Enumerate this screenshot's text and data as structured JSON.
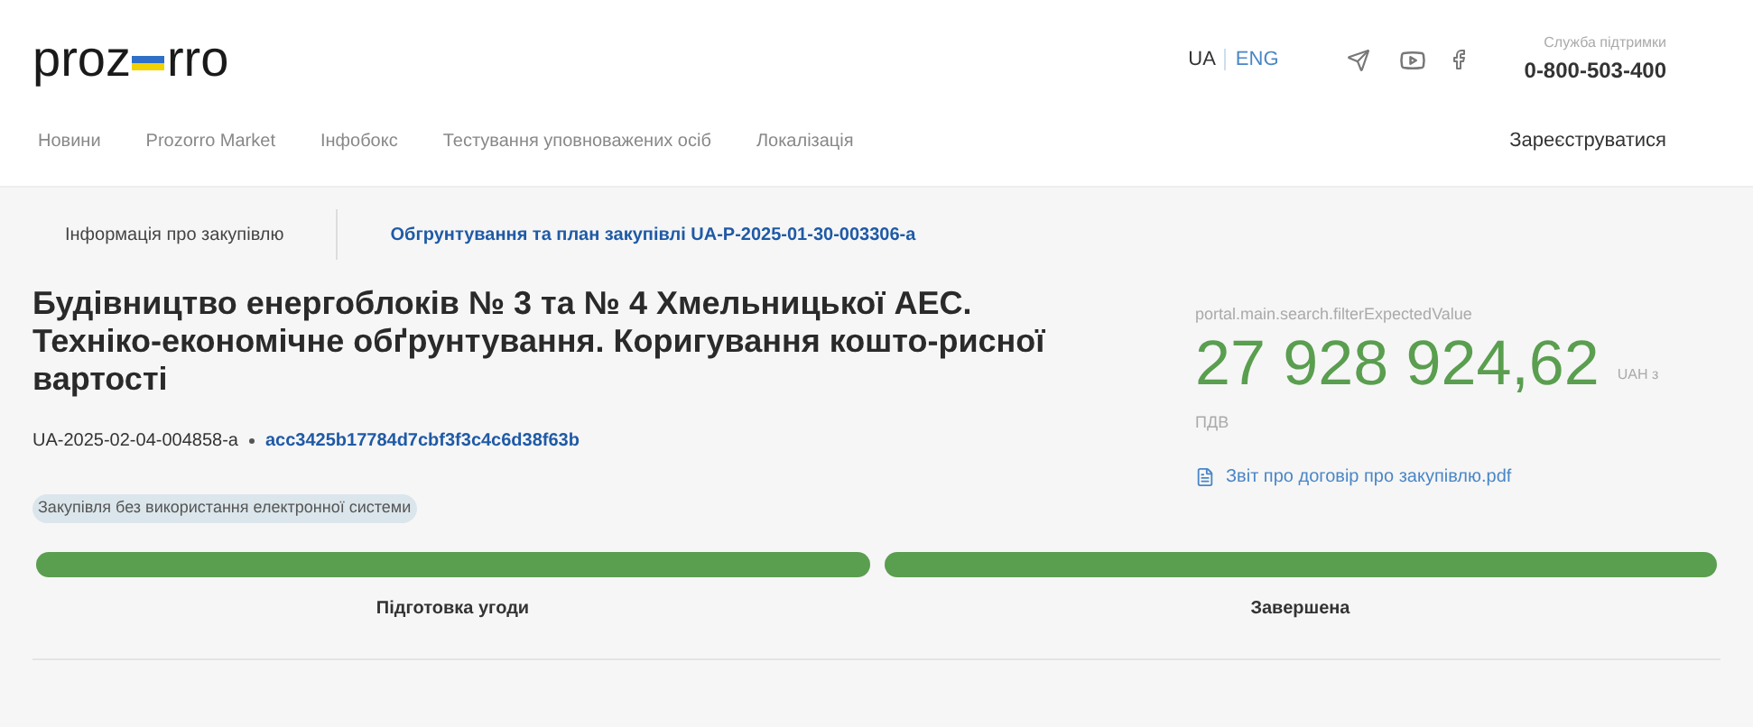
{
  "header": {
    "logo_left": "proz",
    "logo_right": "rro",
    "languages": [
      {
        "label": "UA",
        "selected": true
      },
      {
        "label": "ENG",
        "selected": false
      }
    ],
    "support_label": "Служба підтримки",
    "support_phone": "0-800-503-400"
  },
  "nav": {
    "items": [
      "Новини",
      "Prozorro Market",
      "Інфобокс",
      "Тестування уповноважених осіб",
      "Локалізація"
    ],
    "register": "Зареєструватися"
  },
  "tabs": [
    {
      "label": "Інформація про закупівлю",
      "selected": true
    },
    {
      "label": "Обгрунтування та план закупівлі UA-P-2025-01-30-003306-a",
      "selected": false
    }
  ],
  "tender": {
    "title": "Будівництво енергоблоків № 3 та № 4 Хмельницької АЕС. Техніко-економічне обґрунтування. Коригування кошто-рисної вартості",
    "id": "UA-2025-02-04-004858-a",
    "hash": "acc3425b17784d7cbf3f3c4c6d38f63b",
    "tag": "Закупівля без використання електронної системи"
  },
  "value": {
    "label": "portal.main.search.filterExpectedValue",
    "amount": "27 928 924,62",
    "currency": "UAH з",
    "vat": "ПДВ",
    "document": "Звіт про договір про закупівлю.pdf"
  },
  "stages": [
    {
      "label": "Підготовка угоди",
      "done": true
    },
    {
      "label": "Завершена",
      "done": true
    }
  ]
}
